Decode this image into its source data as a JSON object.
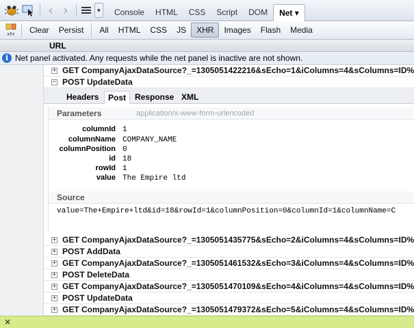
{
  "toolbar": {
    "nav_back": "‹",
    "nav_forward": "›",
    "panel_tabs": [
      {
        "label": "Console"
      },
      {
        "label": "HTML"
      },
      {
        "label": "CSS"
      },
      {
        "label": "Script"
      },
      {
        "label": "DOM"
      },
      {
        "label": "Net ▾",
        "active": true
      }
    ]
  },
  "net_toolbar": {
    "xhr_icon_label": "xhr",
    "clear_label": "Clear",
    "persist_label": "Persist",
    "filters": [
      "All",
      "HTML",
      "CSS",
      "JS",
      "XHR",
      "Images",
      "Flash",
      "Media"
    ],
    "active_filter": "XHR"
  },
  "columns": {
    "url": "URL"
  },
  "info": {
    "message": "Net panel activated. Any requests while the net panel is inactive are not shown."
  },
  "requests": [
    {
      "text": "GET CompanyAjaxDataSource?_=1305051422216&sEcho=1&iColumns=4&sColumns=ID%",
      "expanded": false
    },
    {
      "text": "POST UpdateData",
      "expanded": true
    },
    {
      "text": "GET CompanyAjaxDataSource?_=1305051435775&sEcho=2&iColumns=4&sColumns=ID%",
      "expanded": false
    },
    {
      "text": "POST AddData",
      "expanded": false
    },
    {
      "text": "GET CompanyAjaxDataSource?_=1305051461532&sEcho=3&iColumns=4&sColumns=ID%",
      "expanded": false
    },
    {
      "text": "POST DeleteData",
      "expanded": false
    },
    {
      "text": "GET CompanyAjaxDataSource?_=1305051470109&sEcho=4&iColumns=4&sColumns=ID%",
      "expanded": false
    },
    {
      "text": "POST UpdateData",
      "expanded": false
    },
    {
      "text": "GET CompanyAjaxDataSource?_=1305051479372&sEcho=5&iColumns=4&sColumns=ID%",
      "expanded": false
    }
  ],
  "details": {
    "tabs": [
      "Headers",
      "Post",
      "Response",
      "XML"
    ],
    "active_tab": "Post",
    "parameters_title": "Parameters",
    "content_type": "application/x-www-form-urlencoded",
    "params": [
      {
        "name": "columnId",
        "value": "1"
      },
      {
        "name": "columnName",
        "value": "COMPANY_NAME"
      },
      {
        "name": "columnPosition",
        "value": "0"
      },
      {
        "name": "id",
        "value": "18"
      },
      {
        "name": "rowId",
        "value": "1"
      },
      {
        "name": "value",
        "value": "The Empire ltd"
      }
    ],
    "source_title": "Source",
    "source": "value=The+Empire+ltd&id=18&rowId=1&columnPosition=0&columnId=1&columnName=C"
  },
  "command_line": {
    "close_label": "×"
  },
  "colors": {
    "command_line_bg": "#d6ec8c",
    "info_icon": "#2a6fcf",
    "toolbar_bg": "#dde4ee"
  }
}
